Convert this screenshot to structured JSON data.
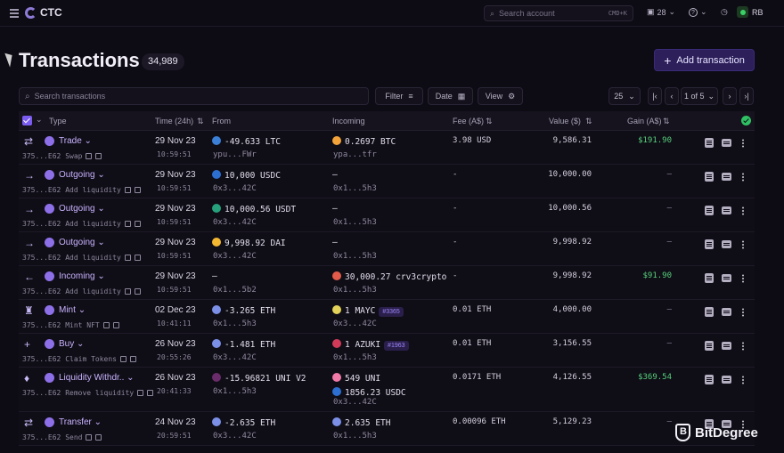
{
  "app": {
    "name": "CTC"
  },
  "topbar": {
    "search_placeholder": "Search account",
    "shortcut": "CMD+K",
    "portfolio_count": "28",
    "help": "?",
    "user_initials": "RB"
  },
  "page": {
    "title": "Transactions",
    "count": "34,989",
    "add_button": "Add transaction"
  },
  "toolbar": {
    "search_placeholder": "Search transactions",
    "filter": "Filter",
    "date": "Date",
    "view": "View",
    "page_size": "25",
    "page_label": "1 of 5"
  },
  "columns": {
    "type": "Type",
    "time": "Time (24h)",
    "from": "From",
    "incoming": "Incoming",
    "fee": "Fee (A$)",
    "value": "Value ($)",
    "gain": "Gain (A$)"
  },
  "rows": [
    {
      "icon": "⇄",
      "type": "Trade",
      "id": "375...E62",
      "sub": "Swap",
      "date": "29 Nov 23",
      "time": "10:59:51",
      "from_amt": "-49.633 LTC",
      "from_addr": "ypu...FWr",
      "from_color": "#3b7fd6",
      "in_amt": "0.2697 BTC",
      "in_addr": "ypa...tfr",
      "in_color": "#f2a33a",
      "fee": "3.98 USD",
      "value": "9,586.31",
      "gain": "$191.90",
      "gain_pos": true
    },
    {
      "icon": "→",
      "type": "Outgoing",
      "id": "375...E62",
      "sub": "Add liquidity",
      "date": "29 Nov 23",
      "time": "10:59:51",
      "from_amt": "10,000 USDC",
      "from_addr": "0x3...42C",
      "from_color": "#2d6fd1",
      "in_amt": "–",
      "in_addr": "0x1...5h3",
      "in_color": "",
      "fee": "-",
      "value": "10,000.00",
      "gain": "–",
      "gain_pos": false
    },
    {
      "icon": "→",
      "type": "Outgoing",
      "id": "375...E62",
      "sub": "Add liquidity",
      "date": "29 Nov 23",
      "time": "10:59:51",
      "from_amt": "10,000.56 USDT",
      "from_addr": "0x3...42C",
      "from_color": "#26a17b",
      "in_amt": "–",
      "in_addr": "0x1...5h3",
      "in_color": "",
      "fee": "-",
      "value": "10,000.56",
      "gain": "–",
      "gain_pos": false
    },
    {
      "icon": "→",
      "type": "Outgoing",
      "id": "375...E62",
      "sub": "Add liquidity",
      "date": "29 Nov 23",
      "time": "10:59:51",
      "from_amt": "9,998.92 DAI",
      "from_addr": "0x3...42C",
      "from_color": "#f4b731",
      "in_amt": "–",
      "in_addr": "0x1...5h3",
      "in_color": "",
      "fee": "-",
      "value": "9,998.92",
      "gain": "–",
      "gain_pos": false
    },
    {
      "icon": "←",
      "type": "Incoming",
      "id": "375...E62",
      "sub": "Add liquidity",
      "date": "29 Nov 23",
      "time": "10:59:51",
      "from_amt": "–",
      "from_addr": "0x1...5b2",
      "from_color": "",
      "in_amt": "30,000.27 crv3crypto",
      "in_addr": "0x1...5h3",
      "in_color": "#e35b4a",
      "fee": "-",
      "value": "9,998.92",
      "gain": "$91.90",
      "gain_pos": true
    },
    {
      "icon": "♜",
      "type": "Mint",
      "id": "375...E62",
      "sub": "Mint NFT",
      "date": "02 Dec 23",
      "time": "10:41:11",
      "from_amt": "-3.265 ETH",
      "from_addr": "0x1...5h3",
      "from_color": "#7b8fe6",
      "in_amt": "1 MAYC",
      "in_tag": "#3365",
      "in_addr": "0x3...42C",
      "in_color": "#e2d25a",
      "fee": "0.01 ETH",
      "value": "4,000.00",
      "gain": "–",
      "gain_pos": false
    },
    {
      "icon": "+",
      "type": "Buy",
      "id": "375...E62",
      "sub": "Claim Tokens",
      "date": "26 Nov 23",
      "time": "20:55:26",
      "from_amt": "-1.481 ETH",
      "from_addr": "0x3...42C",
      "from_color": "#7b8fe6",
      "in_amt": "1 AZUKI",
      "in_tag": "#1963",
      "in_addr": "0x1...5h3",
      "in_color": "#d23a5a",
      "fee": "0.01 ETH",
      "value": "3,156.55",
      "gain": "–",
      "gain_pos": false
    },
    {
      "icon": "♦",
      "type": "Liquidity Withdr..",
      "id": "375...E62",
      "sub": "Remove liquidity",
      "date": "26 Nov 23",
      "time": "20:41:33",
      "from_amt": "-15.96821 UNI V2",
      "from_addr": "0x1...5h3",
      "from_color": "#6a2c6a",
      "in_amt": "549 UNI",
      "in_amt2": "1856.23 USDC",
      "in_addr": "0x3...42C",
      "in_color": "#f07aa8",
      "in_color2": "#2d6fd1",
      "fee": "0.0171 ETH",
      "value": "4,126.55",
      "gain": "$369.54",
      "gain_pos": true
    },
    {
      "icon": "⇄",
      "type": "Transfer",
      "id": "375...E62",
      "sub": "Send",
      "date": "24 Nov 23",
      "time": "20:59:51",
      "from_amt": "-2.635 ETH",
      "from_addr": "0x3...42C",
      "from_color": "#7b8fe6",
      "in_amt": "2.635 ETH",
      "in_addr": "0x1...5h3",
      "in_color": "#7b8fe6",
      "fee": "0.00096 ETH",
      "value": "5,129.23",
      "gain": "–",
      "gain_pos": false
    }
  ],
  "watermark": "BitDegree"
}
